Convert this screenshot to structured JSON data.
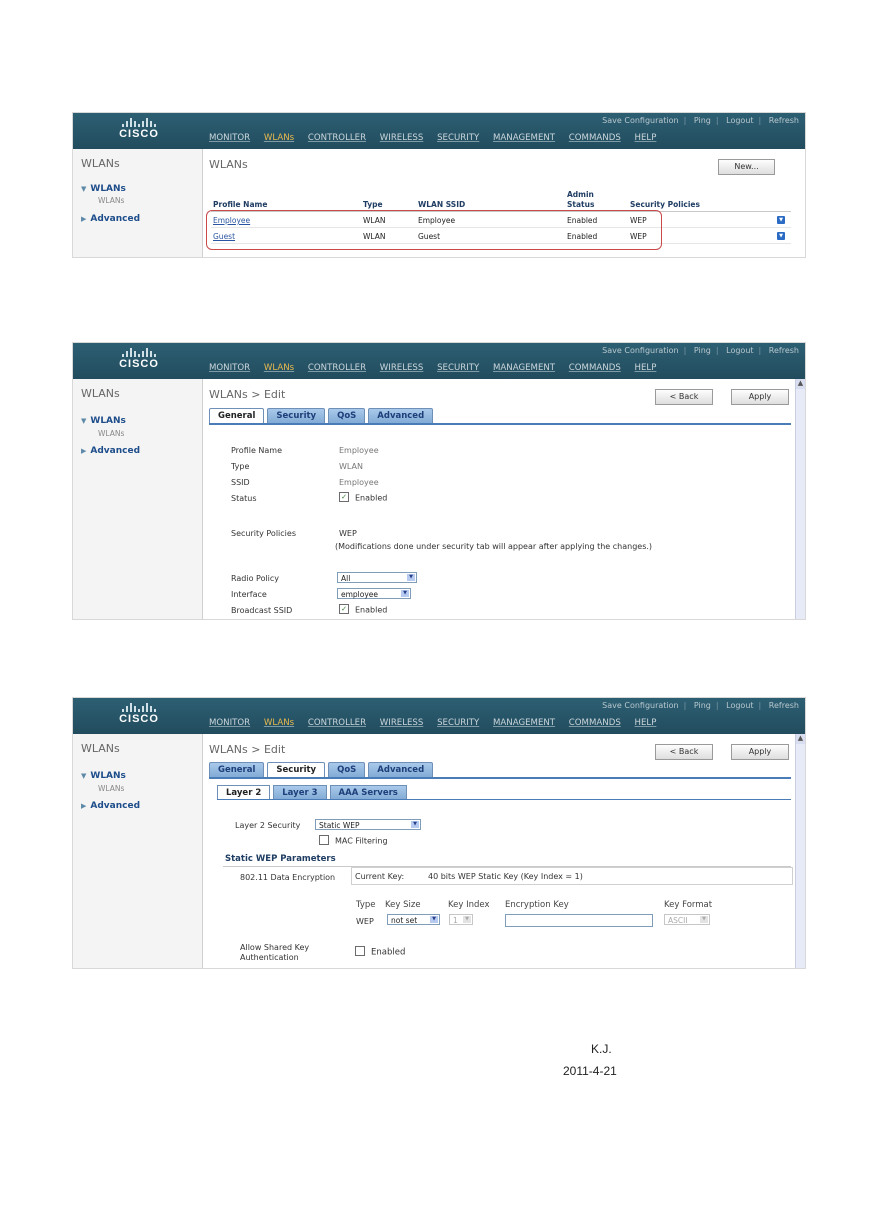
{
  "header": {
    "logo_text": "CISCO",
    "util_links": [
      "Save Configuration",
      "Ping",
      "Logout",
      "Refresh"
    ],
    "menu": [
      "MONITOR",
      "WLANs",
      "CONTROLLER",
      "WIRELESS",
      "SECURITY",
      "MANAGEMENT",
      "COMMANDS",
      "HELP"
    ]
  },
  "nav": {
    "title": "WLANs",
    "wlans": "WLANs",
    "wlans_sub": "WLANs",
    "advanced": "Advanced"
  },
  "screen1": {
    "page_title": "WLANs",
    "new_button": "New...",
    "columns": {
      "profile": "Profile Name",
      "type": "Type",
      "ssid": "WLAN SSID",
      "admin1": "Admin",
      "admin2": "Status",
      "security": "Security Policies"
    },
    "rows": [
      {
        "profile": "Employee",
        "type": "WLAN",
        "ssid": "Employee",
        "status": "Enabled",
        "security": "WEP"
      },
      {
        "profile": "Guest",
        "type": "WLAN",
        "ssid": "Guest",
        "status": "Enabled",
        "security": "WEP"
      }
    ]
  },
  "screen2": {
    "page_title": "WLANs > Edit",
    "back_button": "< Back",
    "apply_button": "Apply",
    "tabs": [
      "General",
      "Security",
      "QoS",
      "Advanced"
    ],
    "fields": {
      "profile_label": "Profile Name",
      "profile_value": "Employee",
      "type_label": "Type",
      "type_value": "WLAN",
      "ssid_label": "SSID",
      "ssid_value": "Employee",
      "status_label": "Status",
      "status_value": "Enabled",
      "secpol_label": "Security Policies",
      "secpol_value": "WEP",
      "secpol_note": "(Modifications done under security tab will appear after applying the changes.)",
      "radio_label": "Radio Policy",
      "radio_value": "All",
      "iface_label": "Interface",
      "iface_value": "employee",
      "bcast_label": "Broadcast SSID",
      "bcast_value": "Enabled"
    }
  },
  "screen3": {
    "page_title": "WLANs > Edit",
    "back_button": "< Back",
    "apply_button": "Apply",
    "tabs": [
      "General",
      "Security",
      "QoS",
      "Advanced"
    ],
    "subtabs": [
      "Layer 2",
      "Layer 3",
      "AAA Servers"
    ],
    "l2_label": "Layer 2 Security",
    "l2_value": "Static WEP",
    "mac_filter": "MAC Filtering",
    "section": "Static WEP Parameters",
    "enc_label": "802.11 Data Encryption",
    "current_key_label": "Current Key:",
    "current_key_value": "40 bits WEP Static Key (Key Index = 1)",
    "cols": {
      "type": "Type",
      "keysize": "Key Size",
      "keyindex": "Key Index",
      "enckey": "Encryption Key",
      "keyformat": "Key Format"
    },
    "row": {
      "type": "WEP",
      "keysize": "not set",
      "keyindex": "1",
      "keyformat": "ASCII"
    },
    "shared_label1": "Allow Shared Key",
    "shared_label2": "Authentication",
    "shared_value": "Enabled"
  },
  "footer": {
    "author": "K.J.",
    "date": "2011-4-21"
  }
}
